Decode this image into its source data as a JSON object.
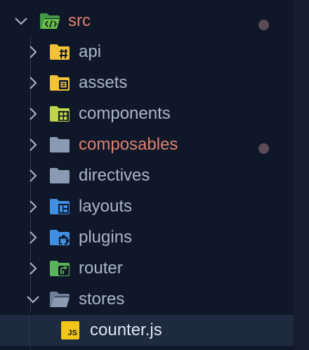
{
  "explorer": {
    "root": {
      "name": "src",
      "expanded": true,
      "modified": true,
      "icon": "folder-src-open-icon"
    },
    "folders": [
      {
        "name": "api",
        "expanded": false,
        "modified": false,
        "icon": "folder-api-icon",
        "color": "#f3c337"
      },
      {
        "name": "assets",
        "expanded": false,
        "modified": false,
        "icon": "folder-assets-icon",
        "color": "#f3c337"
      },
      {
        "name": "components",
        "expanded": false,
        "modified": false,
        "icon": "folder-components-icon",
        "color": "#c0d44b"
      },
      {
        "name": "composables",
        "expanded": false,
        "modified": true,
        "icon": "folder-generic-icon",
        "color": "#8b9bb3"
      },
      {
        "name": "directives",
        "expanded": false,
        "modified": false,
        "icon": "folder-generic-icon",
        "color": "#8b9bb3"
      },
      {
        "name": "layouts",
        "expanded": false,
        "modified": false,
        "icon": "folder-layout-icon",
        "color": "#3f8fe3"
      },
      {
        "name": "plugins",
        "expanded": false,
        "modified": false,
        "icon": "folder-plugin-icon",
        "color": "#3f8fe3"
      },
      {
        "name": "router",
        "expanded": false,
        "modified": false,
        "icon": "folder-router-icon",
        "color": "#5bb45d"
      },
      {
        "name": "stores",
        "expanded": true,
        "modified": false,
        "icon": "folder-open-icon",
        "color": "#8b9bb3"
      }
    ],
    "files": [
      {
        "name": "counter.js",
        "selected": true,
        "icon": "javascript-file-icon",
        "icon_text": "JS",
        "color": "#f5c61a"
      }
    ],
    "colors": {
      "background": "#0f1828",
      "label": "#aab6c8",
      "modified_label": "#e0806f",
      "modified_dot": "#5c4b55",
      "selection": "#1d2a40"
    }
  }
}
